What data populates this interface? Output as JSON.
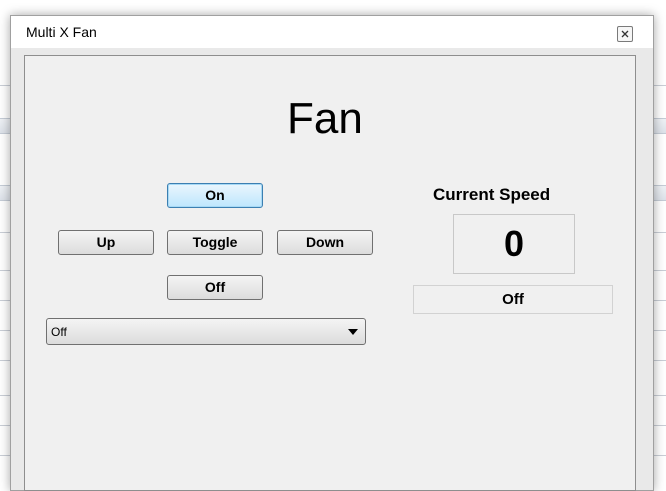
{
  "window": {
    "title": "Multi X Fan"
  },
  "main": {
    "heading": "Fan"
  },
  "controls": {
    "on_label": "On",
    "up_label": "Up",
    "toggle_label": "Toggle",
    "down_label": "Down",
    "off_label": "Off"
  },
  "speed_select": {
    "selected": "Off"
  },
  "status": {
    "current_speed_label": "Current Speed",
    "current_speed_value": "0",
    "state": "Off"
  },
  "icons": {
    "close": "close-icon",
    "dropdown": "chevron-down-icon"
  },
  "colors": {
    "focused_button_border": "#3c7fb1",
    "focused_button_fill": "#bee6fd",
    "client_background": "#f0f0f0"
  }
}
